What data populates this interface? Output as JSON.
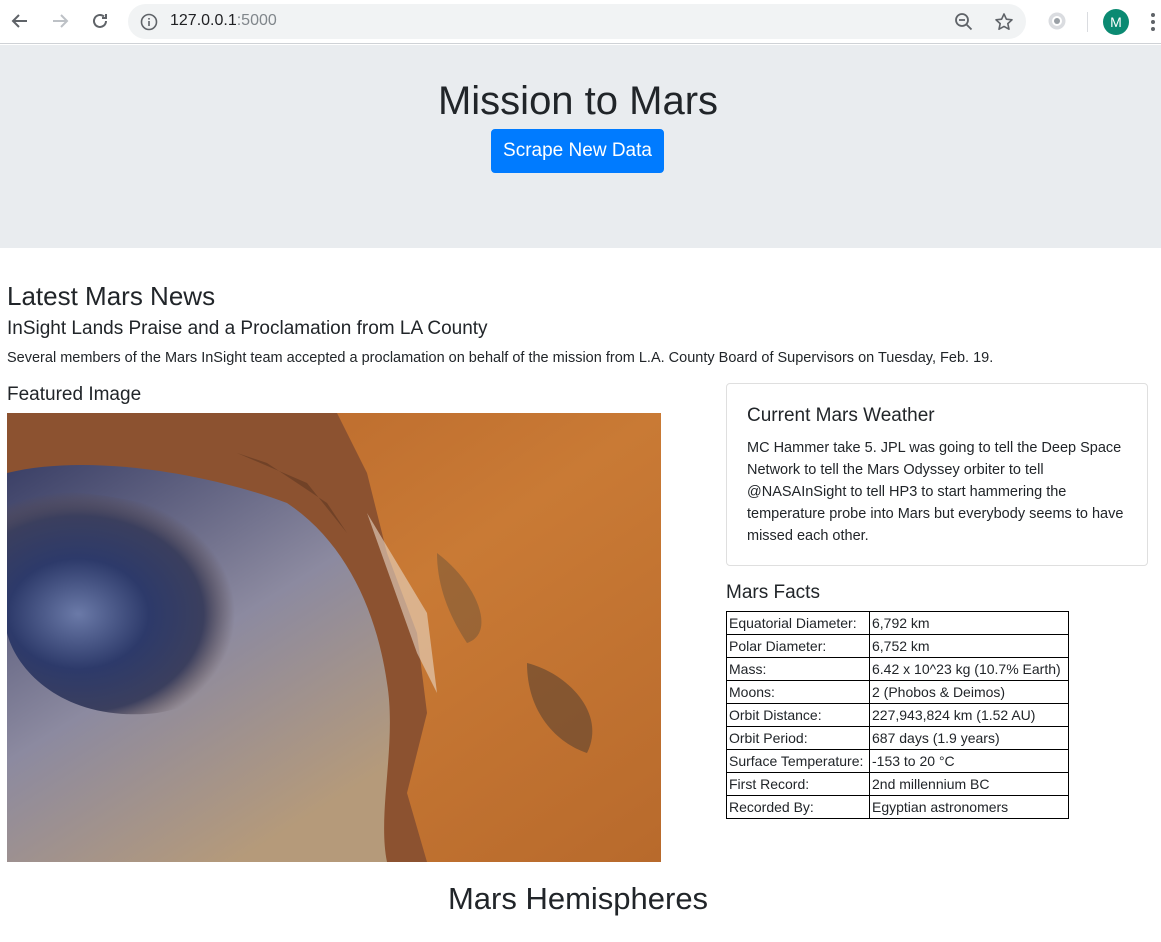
{
  "browser": {
    "url_host": "127.0.0.1",
    "url_port": ":5000",
    "avatar_letter": "M"
  },
  "header": {
    "title": "Mission to Mars",
    "scrape_button": "Scrape New Data"
  },
  "news": {
    "heading": "Latest Mars News",
    "title": "InSight Lands Praise and a Proclamation from LA County",
    "paragraph": "Several members of the Mars InSight team accepted a proclamation on behalf of the mission from L.A. County Board of Supervisors on Tuesday, Feb. 19."
  },
  "featured": {
    "heading": "Featured Image"
  },
  "weather": {
    "heading": "Current Mars Weather",
    "text": "MC Hammer take 5. JPL was going to tell the Deep Space Network to tell the Mars Odyssey orbiter to tell @NASAInSight to tell HP3 to start hammering the temperature probe into Mars but everybody seems to have missed each other."
  },
  "facts": {
    "heading": "Mars Facts",
    "rows": [
      {
        "label": "Equatorial Diameter:",
        "value": "6,792 km"
      },
      {
        "label": "Polar Diameter:",
        "value": "6,752 km"
      },
      {
        "label": "Mass:",
        "value": "6.42 x 10^23 kg (10.7% Earth)"
      },
      {
        "label": "Moons:",
        "value": "2 (Phobos & Deimos)"
      },
      {
        "label": "Orbit Distance:",
        "value": "227,943,824 km (1.52 AU)"
      },
      {
        "label": "Orbit Period:",
        "value": "687 days (1.9 years)"
      },
      {
        "label": "Surface Temperature:",
        "value": "-153 to 20 °C"
      },
      {
        "label": "First Record:",
        "value": "2nd millennium BC"
      },
      {
        "label": "Recorded By:",
        "value": "Egyptian astronomers"
      }
    ]
  },
  "hemispheres": {
    "heading": "Mars Hemispheres"
  },
  "colors": {
    "primary": "#007bff",
    "jumbotron_bg": "#e9ecef",
    "text": "#212529",
    "avatar_bg": "#0b8a72"
  }
}
